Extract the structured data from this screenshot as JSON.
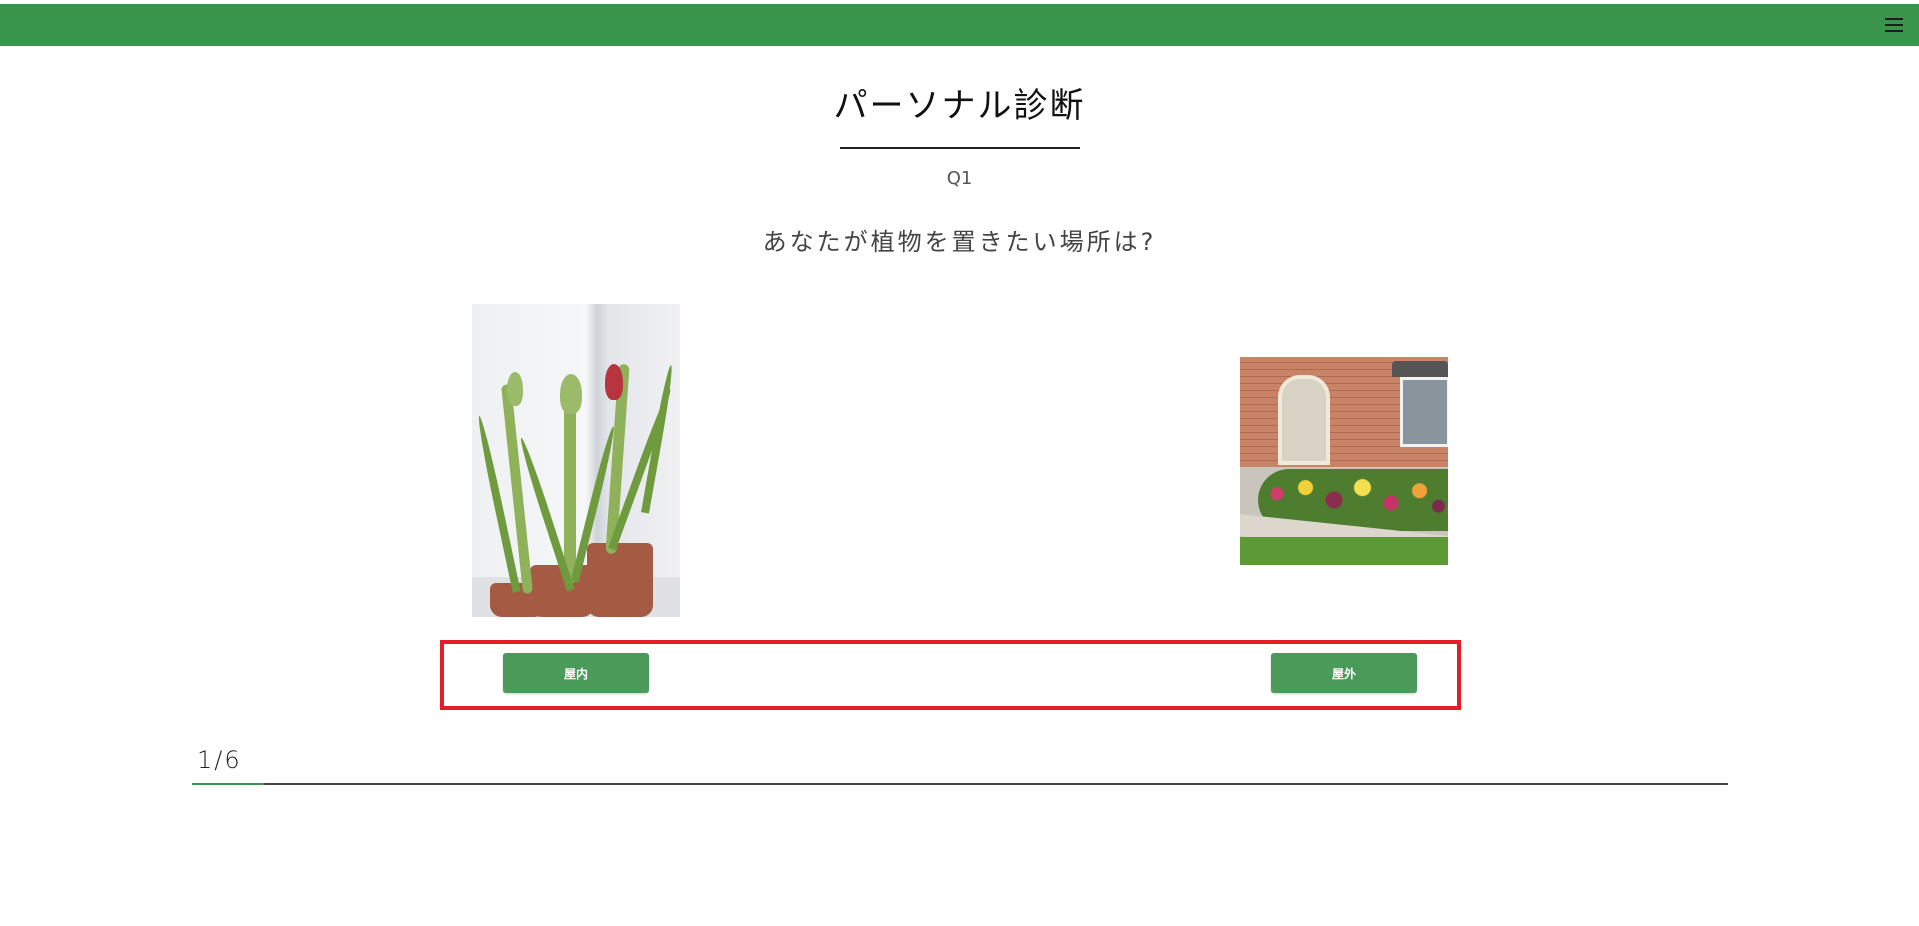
{
  "header": {
    "bar_color": "#39954c",
    "menu_icon": "hamburger-menu-icon"
  },
  "page": {
    "title": "パーソナル診断",
    "question_number": "Q1",
    "question_text": "あなたが植物を置きたい場所は?"
  },
  "choices": [
    {
      "label": "屋内",
      "image": "indoor potted amaryllis plants by window"
    },
    {
      "label": "屋外",
      "image": "house front with outdoor flower garden"
    }
  ],
  "progress": {
    "label": "1/6",
    "fraction": 0.047
  },
  "colors": {
    "accent": "#39954c",
    "button": "#4a9a5a",
    "highlight": "#e31e2a"
  }
}
